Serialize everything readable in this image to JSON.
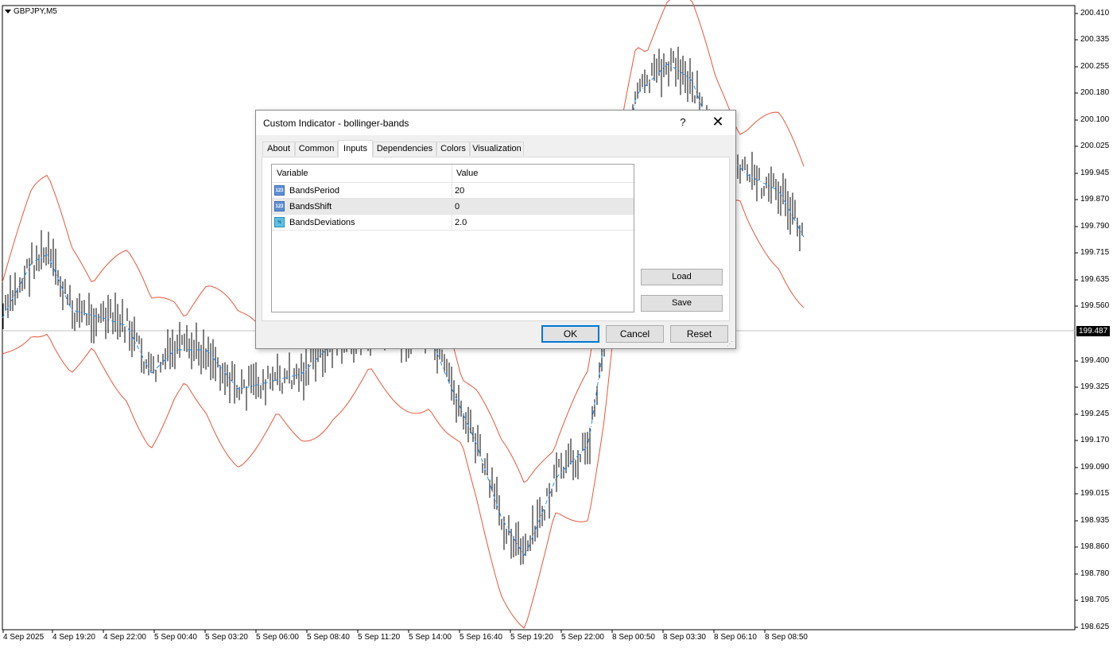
{
  "chart": {
    "symbol": "GBPJPY,M5",
    "current_price": "199.487",
    "price_axis": [
      "200.410",
      "200.335",
      "200.255",
      "200.180",
      "200.100",
      "200.025",
      "199.945",
      "199.870",
      "199.790",
      "199.715",
      "199.635",
      "199.560",
      "199.400",
      "199.325",
      "199.245",
      "199.170",
      "199.090",
      "199.015",
      "198.935",
      "198.860",
      "198.780",
      "198.705",
      "198.625"
    ],
    "time_axis": [
      "4 Sep 2025",
      "4 Sep 19:20",
      "4 Sep 22:00",
      "5 Sep 00:40",
      "5 Sep 03:20",
      "5 Sep 06:00",
      "5 Sep 08:40",
      "5 Sep 11:20",
      "5 Sep 14:00",
      "5 Sep 16:40",
      "5 Sep 19:20",
      "5 Sep 22:00",
      "8 Sep 00:50",
      "8 Sep 03:30",
      "8 Sep 06:10",
      "8 Sep 08:50"
    ],
    "colors": {
      "bands": "#e8573a",
      "middle": "#1e90ff",
      "bars": "#000000"
    }
  },
  "dialog": {
    "title": "Custom Indicator - bollinger-bands",
    "help": "?",
    "close": "✕",
    "tabs": [
      "About",
      "Common",
      "Inputs",
      "Dependencies",
      "Colors",
      "Visualization"
    ],
    "active_tab": "Inputs",
    "grid": {
      "headers": {
        "variable": "Variable",
        "value": "Value"
      },
      "rows": [
        {
          "name": "BandsPeriod",
          "value": "20",
          "icon": "int-icon",
          "icon_text": "123"
        },
        {
          "name": "BandsShift",
          "value": "0",
          "icon": "int-icon",
          "icon_text": "123"
        },
        {
          "name": "BandsDeviations",
          "value": "2.0",
          "icon": "double-icon",
          "icon_text": "½"
        }
      ]
    },
    "buttons": {
      "load": "Load",
      "save": "Save",
      "ok": "OK",
      "cancel": "Cancel",
      "reset": "Reset"
    }
  }
}
